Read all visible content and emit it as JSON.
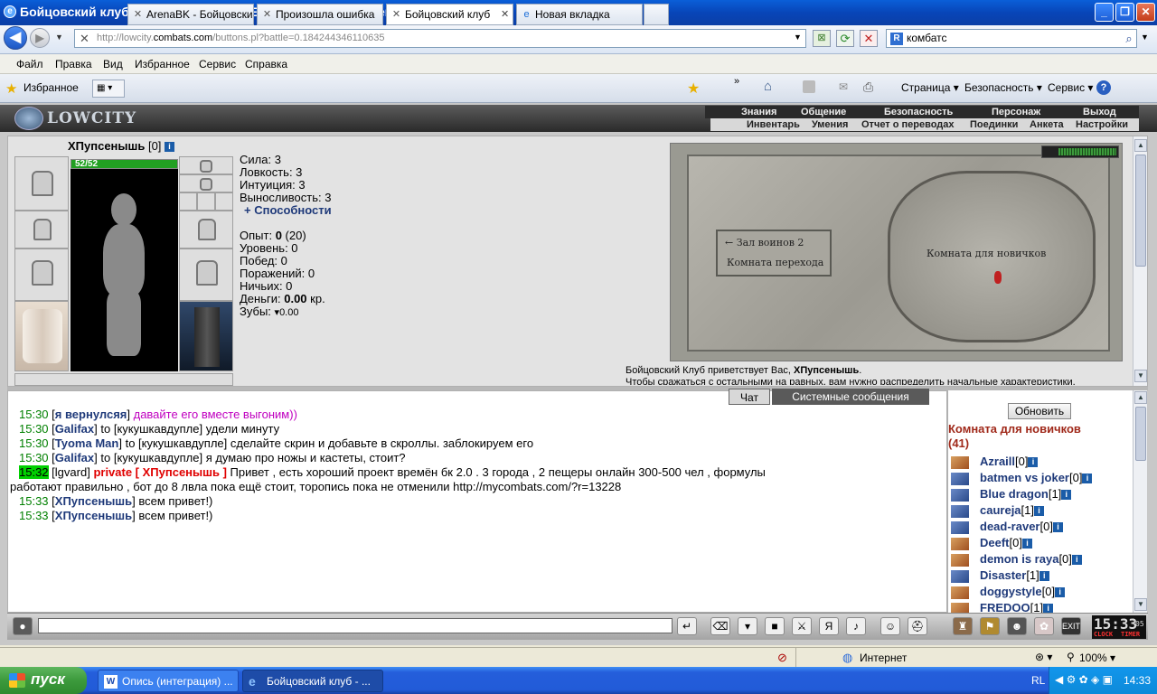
{
  "window": {
    "title": "Бойцовский клуб - Windows Internet Explorer предоставлен: Rambler"
  },
  "nav": {
    "url_prefix": "http://lowcity.",
    "url_domain": "combats.com",
    "url_suffix": "/buttons.pl?battle=0.184244346110635",
    "search_text": "комбатс"
  },
  "menu": [
    "Файл",
    "Правка",
    "Вид",
    "Избранное",
    "Сервис",
    "Справка"
  ],
  "favorites": {
    "label": "Избранное"
  },
  "tabs": [
    "ArenaBK - Бойцовски...",
    "Произошла ошибка",
    "Бойцовский клуб",
    "Новая вкладка"
  ],
  "toolbar": {
    "page": "Страница",
    "security": "Безопасность",
    "service": "Сервис"
  },
  "game": {
    "logo": "LOWCITY",
    "top_menu": [
      "Знания",
      "Общение",
      "Безопасность",
      "Персонаж",
      "Выход"
    ],
    "sub_menu": [
      "Инвентарь",
      "Умения",
      "Отчет о переводах",
      "Поединки",
      "Анкета",
      "Настройки"
    ],
    "char_name": "ХПупсенышь",
    "char_level": "[0]",
    "hp": "52/52",
    "stats": {
      "strength": "Сила: 3",
      "agility": "Ловкость: 3",
      "intuition": "Интуиция: 3",
      "endurance": "Выносливость: 3",
      "abilities": "+ Способности"
    },
    "exp_label": "Опыт:",
    "exp_value": "0",
    "exp_next": "(20)",
    "level": "Уровень: 0",
    "wins": "Побед: 0",
    "losses": "Поражений: 0",
    "draws": "Ничьих: 0",
    "money_label": "Деньги:",
    "money_value": "0.00",
    "money_unit": "кр.",
    "teeth_label": "Зубы:",
    "teeth_value": "0.00",
    "map": {
      "hall": "← Зал воинов 2",
      "transfer": "Комната перехода",
      "novice": "Комната для новичков"
    },
    "welcome_prefix": "Бойцовский Клуб приветствует Вас,",
    "welcome_name": "ХПупсенышь",
    "welcome_line2": "Чтобы сражаться с остальными на равных, вам нужно распределить начальные характеристики."
  },
  "chat": {
    "tab_chat": "Чат",
    "tab_system": "Системные сообщения",
    "messages": [
      {
        "time": "15:30",
        "nick": "я вернулсяя",
        "text": "давайте его вместе выгоним))"
      },
      {
        "time": "15:30",
        "nick": "Galifax",
        "to": "to [кукушкавдупле]",
        "text": "удели минуту"
      },
      {
        "time": "15:30",
        "nick": "Tyoma Man",
        "to": "to [кукушкавдупле]",
        "text": "сделайте скрин и добавьте в скроллы. заблокируем его"
      },
      {
        "time": "15:30",
        "nick": "Galifax",
        "to": "to [кукушкавдупле]",
        "text": "я думаю про ножы и кастеты, стоит?"
      },
      {
        "time": "15:32",
        "nick": "lgvard",
        "private": "private [ ХПупсенышь ]",
        "text": "Привет , есть хороший проект времён бк 2.0 . 3 города , 2 пещеры онлайн 300-500 чел , формулы",
        "text2": "работают правильно , бот до 8 лвла пока ещё стоит, торопись пока не отменили http://mycombats.com/?r=13228"
      },
      {
        "time": "15:33",
        "nick": "ХПупсенышь",
        "text": "всем привет!)"
      },
      {
        "time": "15:33",
        "nick": "ХПупсенышь",
        "text": "всем привет!)"
      }
    ]
  },
  "room": {
    "refresh": "Обновить",
    "name": "Комната для новичков",
    "count": "(41)",
    "users": [
      {
        "name": "Azraill",
        "level": "[0]"
      },
      {
        "name": "batmen vs joker",
        "level": "[0]"
      },
      {
        "name": "Blue dragon",
        "level": "[1]"
      },
      {
        "name": "caureja",
        "level": "[1]"
      },
      {
        "name": "dead-raver",
        "level": "[0]"
      },
      {
        "name": "Deeft",
        "level": "[0]"
      },
      {
        "name": "demon is raya",
        "level": "[0]"
      },
      {
        "name": "Disaster",
        "level": "[1]"
      },
      {
        "name": "doggystyle",
        "level": "[0]"
      },
      {
        "name": "FREDOO",
        "level": "[1]"
      }
    ]
  },
  "clock": {
    "time": "15:33",
    "seconds": "05",
    "label1": "CLOCK",
    "label2": "TIMER"
  },
  "status": {
    "zone": "Интернет",
    "zoom": "100%"
  },
  "taskbar": {
    "start": "пуск",
    "task1": "Опись (интеграция) ...",
    "task2": "Бойцовский клуб - ...",
    "lang": "RL",
    "time": "14:33"
  },
  "colors": {
    "xp_blue": "#245edb",
    "hp_green": "#22a022",
    "nick": "#1f3a7a",
    "private": "#e00000"
  }
}
